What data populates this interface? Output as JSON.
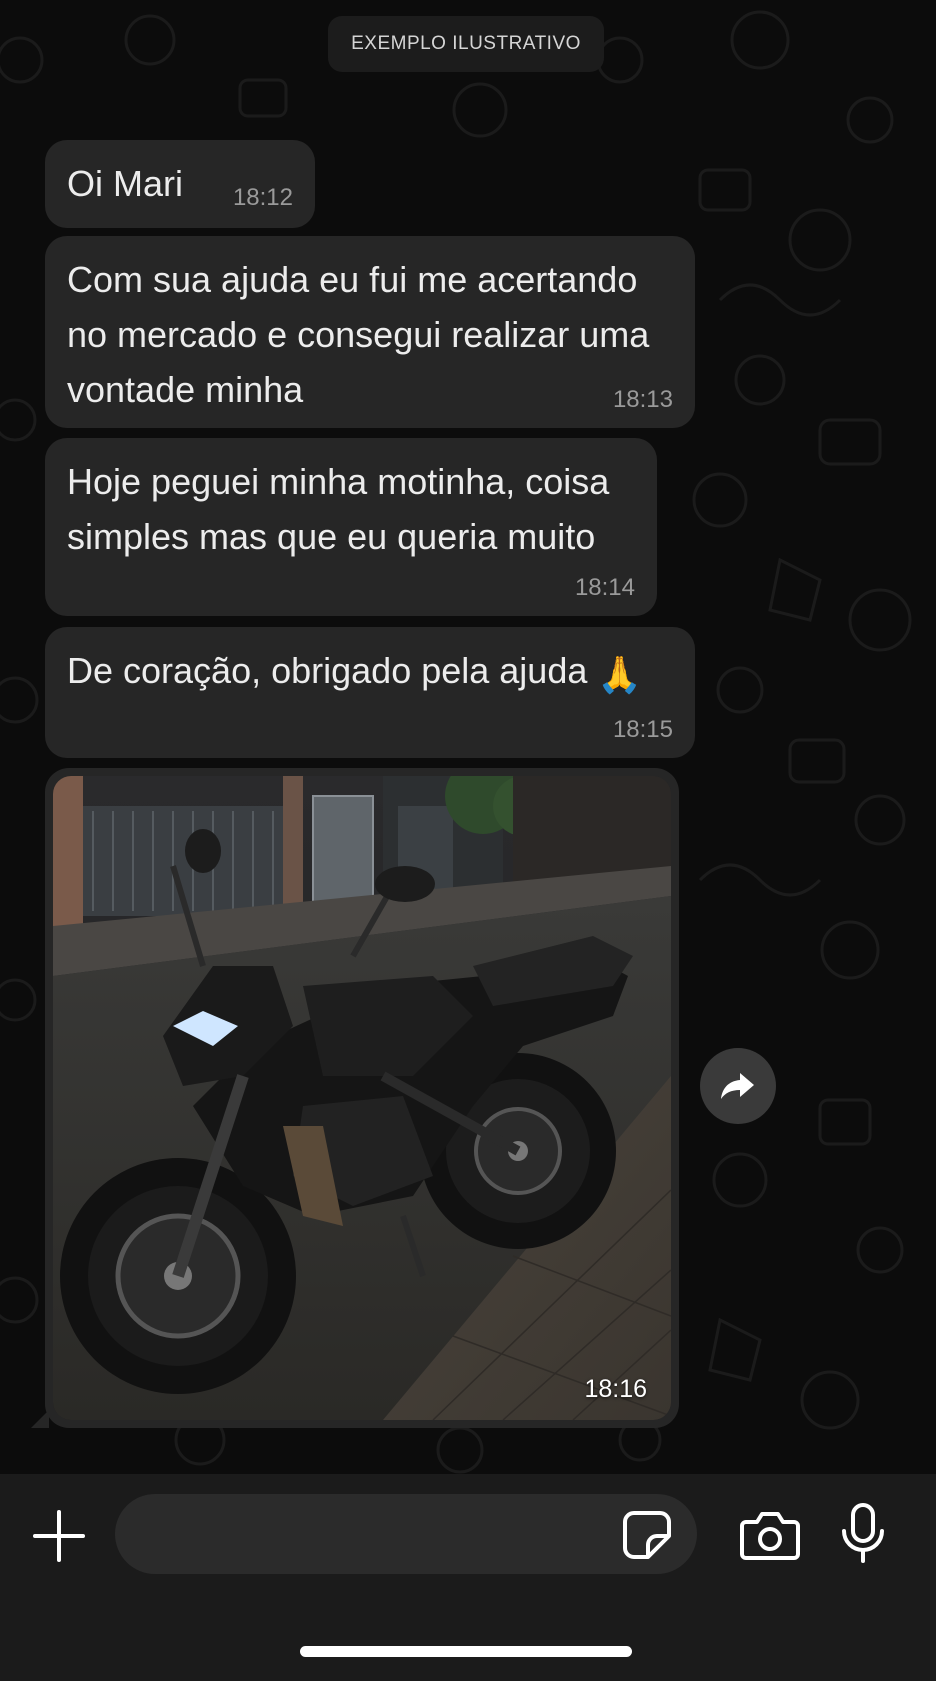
{
  "chat": {
    "system_notice": "EXEMPLO ILUSTRATIVO",
    "messages": [
      {
        "text": "Oi Mari",
        "time": "18:12"
      },
      {
        "text": "Com sua ajuda eu fui me acertando\nno mercado e consegui realizar uma\nvontade minha",
        "time": "18:13"
      },
      {
        "text": "Hoje peguei minha motinha, coisa\nsimples mas que eu queria muito",
        "time": "18:14"
      },
      {
        "text": "De coração, obrigado pela ajuda",
        "emoji": "🙏",
        "time": "18:15"
      }
    ],
    "image_message": {
      "subject": "black-naked-motorcycle-parked-on-street-at-night",
      "time": "18:16"
    }
  },
  "icons": {
    "forward": "forward-arrow-icon",
    "attach": "plus-icon",
    "sticker": "sticker-icon",
    "camera": "camera-icon",
    "microphone": "microphone-icon"
  },
  "composer": {
    "value": "",
    "placeholder": ""
  },
  "colors": {
    "background": "#0c0c0c",
    "bubble": "#262626",
    "input_bar": "#1b1b1b",
    "input_field": "#2b2b2b",
    "timestamp": "#9a9a9a"
  }
}
